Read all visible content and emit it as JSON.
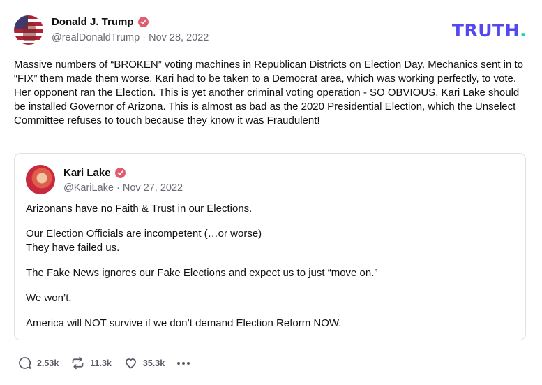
{
  "post": {
    "author": {
      "name": "Donald J. Trump",
      "handle": "@realDonaldTrump",
      "separator": "·",
      "date": "Nov 28, 2022",
      "verified_icon": "verified-badge-icon"
    },
    "brand": {
      "text": "TRUTH",
      "dot": ".",
      "color": "#5448ee",
      "dot_color": "#17d7b4"
    },
    "body": "Massive numbers of “BROKEN” voting machines in Republican Districts on Election Day. Mechanics sent in to “FIX” them made them worse. Kari had to be taken to a Democrat area, which was working perfectly, to vote. Her opponent ran the Election. This is yet another criminal voting operation - SO OBVIOUS. Kari Lake should be installed Governor of Arizona. This is almost as bad as the 2020 Presidential Election, which the Unselect Committee refuses to touch because they know it was Fraudulent!",
    "quoted": {
      "name": "Kari Lake",
      "handle": "@KariLake",
      "separator": "·",
      "date": "Nov 27, 2022",
      "paragraphs": [
        "Arizonans have no Faith & Trust in our Elections.",
        "Our Election Officials are incompetent (…or worse)\nThey have failed us.",
        "The Fake News ignores our Fake Elections and expect us to just “move on.”",
        "We won’t.",
        "America will NOT survive if we don’t demand Election Reform NOW."
      ]
    },
    "actions": {
      "replies": "2.53k",
      "retruths": "11.3k",
      "likes": "35.3k",
      "reply_icon": "comment-icon",
      "retruth_icon": "repost-icon",
      "like_icon": "heart-icon",
      "more_icon": "more-icon"
    },
    "accent_colors": {
      "verified": "#e05d70",
      "muted_text": "#6b6b75"
    }
  }
}
